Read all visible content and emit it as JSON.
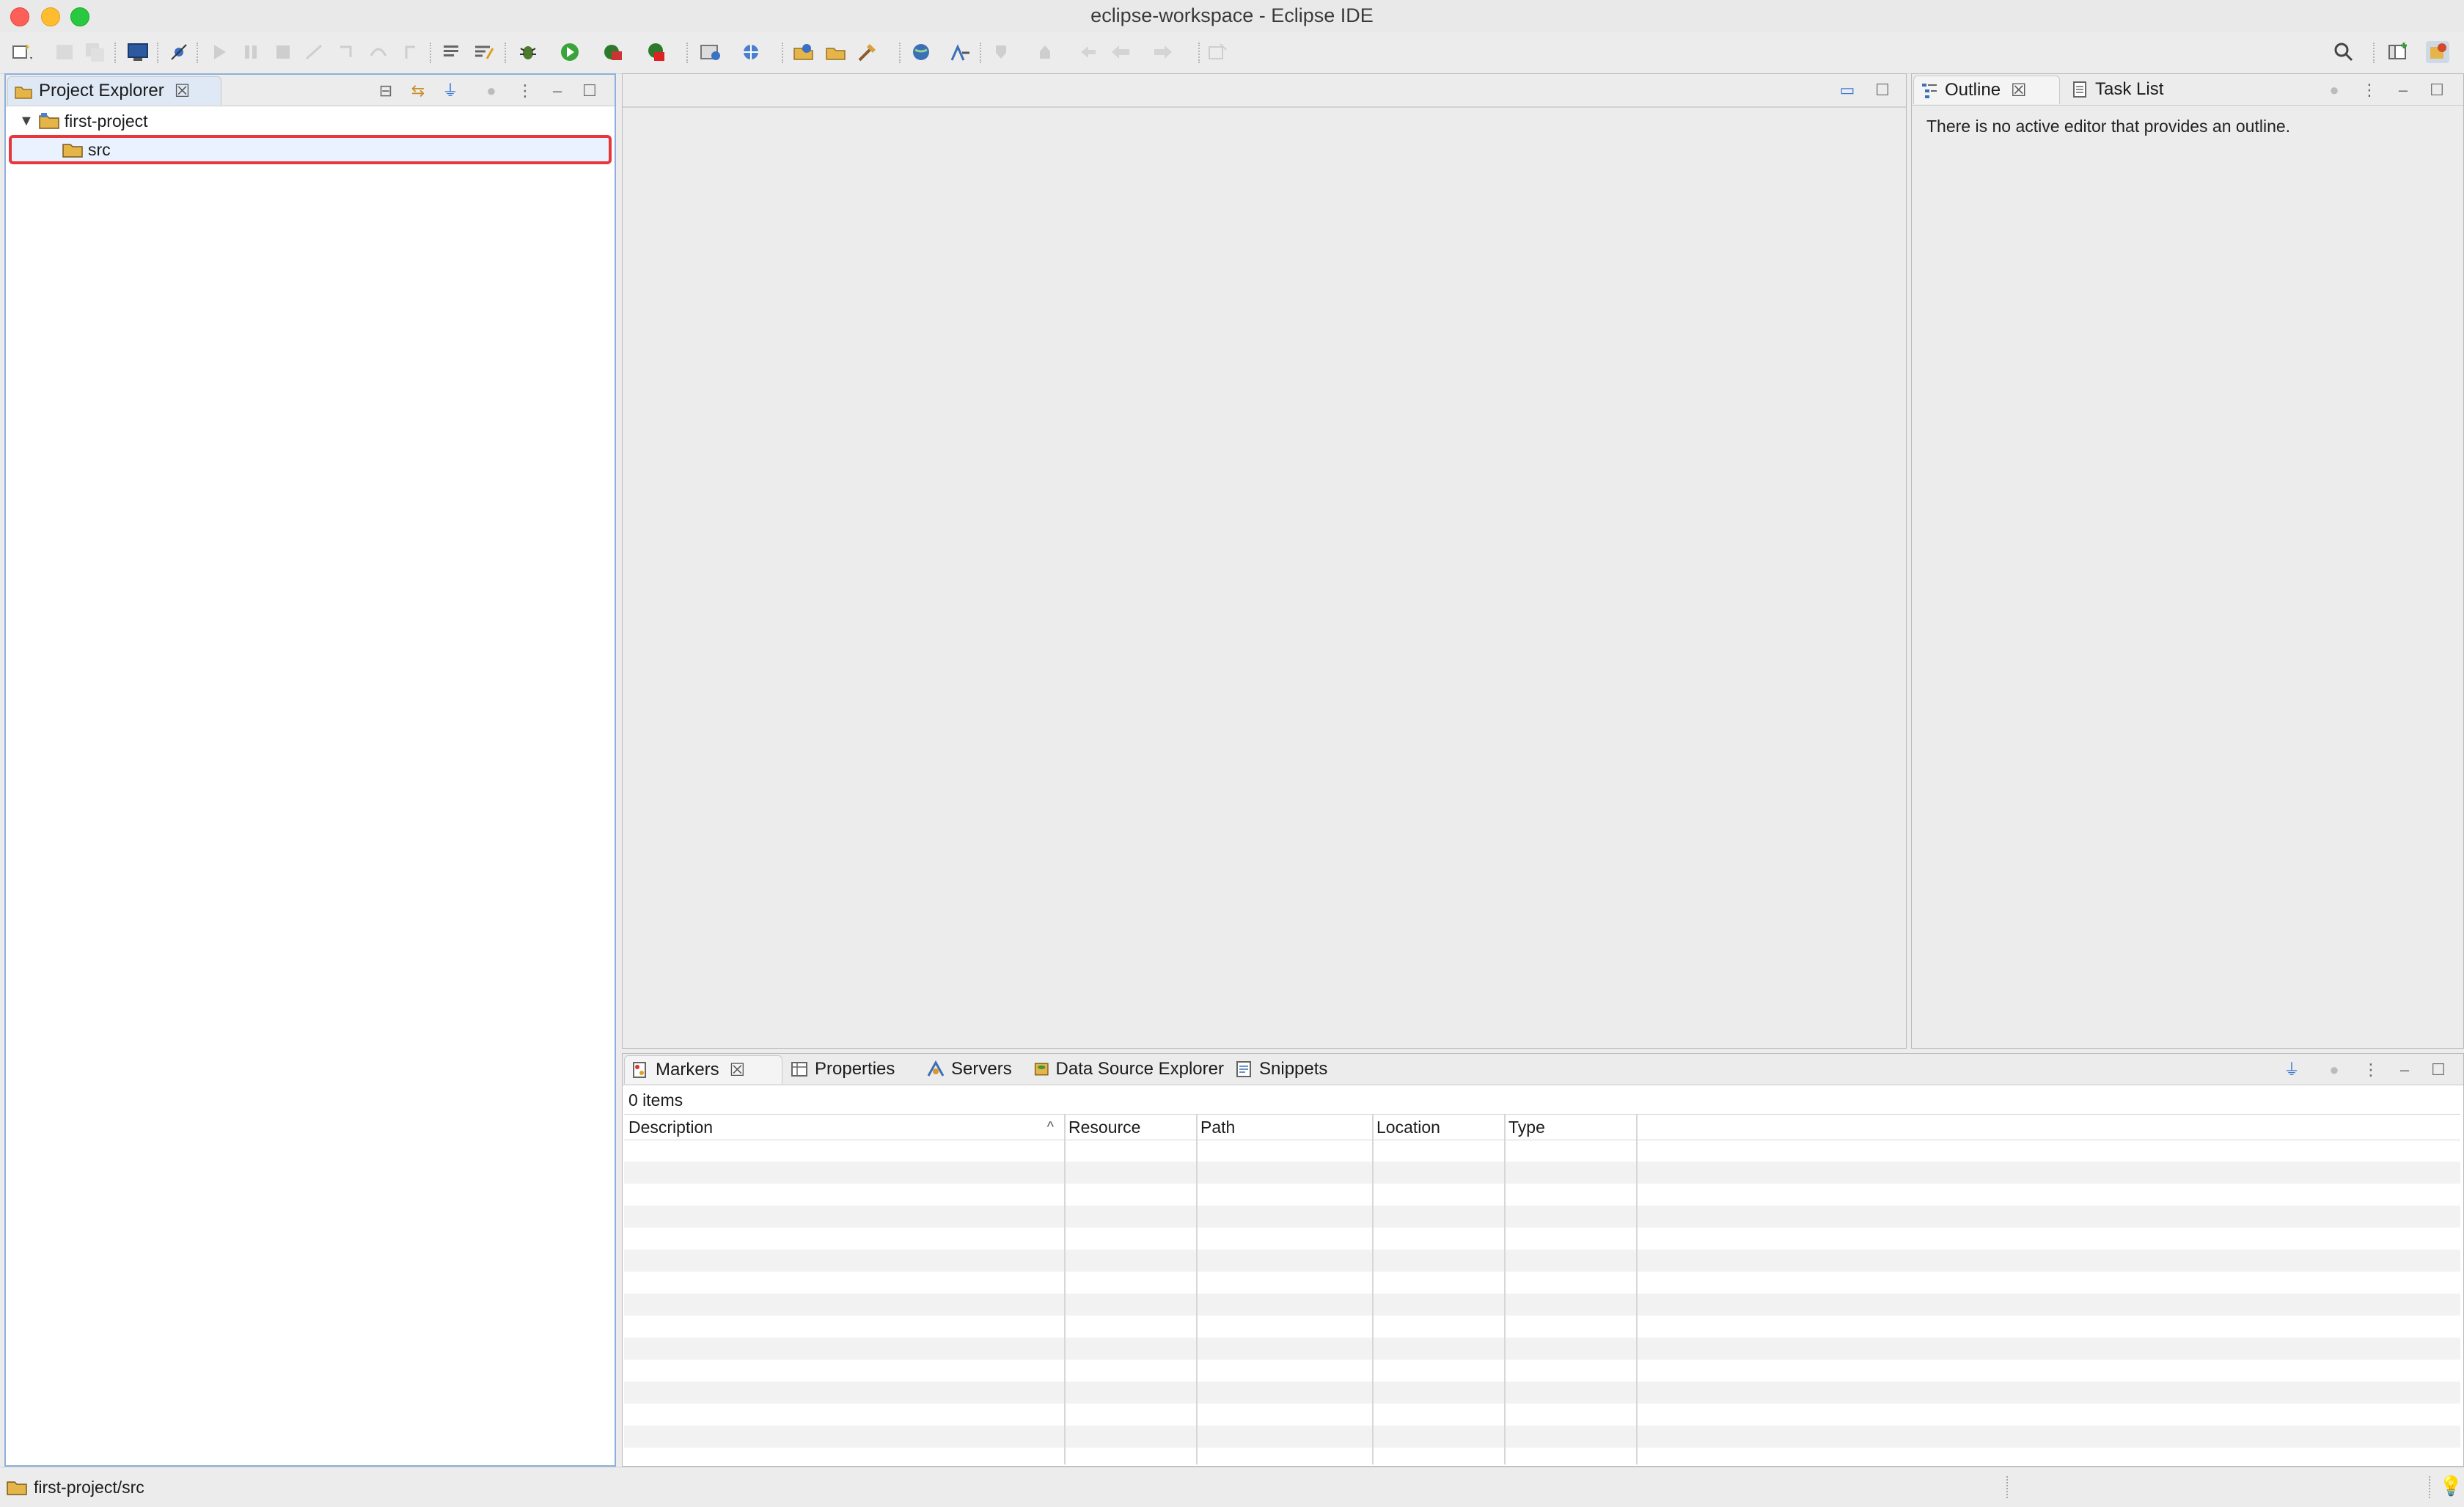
{
  "window": {
    "title": "eclipse-workspace - Eclipse IDE"
  },
  "toolbar": {
    "icons": [
      "new-icon",
      "save-icon",
      "save-all-icon",
      "terminal-icon",
      "skip-breakpoints-icon",
      "resume-icon",
      "suspend-icon",
      "terminate-icon",
      "disconnect-icon",
      "step-into-icon",
      "step-over-icon",
      "step-return-icon",
      "open-task-icon",
      "toggle-mark-icon",
      "debug-icon",
      "run-icon",
      "coverage-icon",
      "run-external-tools-icon",
      "new-server-icon",
      "new-web-service-icon",
      "open-type-icon",
      "open-resource-icon",
      "open-search-icon",
      "open-browser-icon",
      "open-perspective-icon",
      "next-annotation-icon",
      "prev-annotation-icon",
      "last-edit-icon",
      "back-icon",
      "forward-icon",
      "pin-editor-icon",
      "search-icon",
      "open-perspective-button-icon",
      "java-ee-perspective-icon"
    ]
  },
  "project_explorer": {
    "tab_label": "Project Explorer",
    "tree": [
      {
        "label": "first-project",
        "expanded": true,
        "level": 0
      },
      {
        "label": "src",
        "level": 1,
        "selected": true
      }
    ]
  },
  "outline": {
    "tabs": [
      {
        "label": "Outline",
        "active": true
      },
      {
        "label": "Task List",
        "active": false
      }
    ],
    "message": "There is no active editor that provides an outline."
  },
  "bottom_panel": {
    "tabs": [
      {
        "label": "Markers",
        "active": true
      },
      {
        "label": "Properties",
        "active": false
      },
      {
        "label": "Servers",
        "active": false
      },
      {
        "label": "Data Source Explorer",
        "active": false
      },
      {
        "label": "Snippets",
        "active": false
      }
    ],
    "items_count": "0 items",
    "columns": [
      "Description",
      "Resource",
      "Path",
      "Location",
      "Type"
    ],
    "sort_indicator": "^"
  },
  "status_bar": {
    "path": "first-project/src"
  },
  "colors": {
    "selection_highlight": "#e8363a",
    "active_tab_accent": "#3d7bd8"
  }
}
